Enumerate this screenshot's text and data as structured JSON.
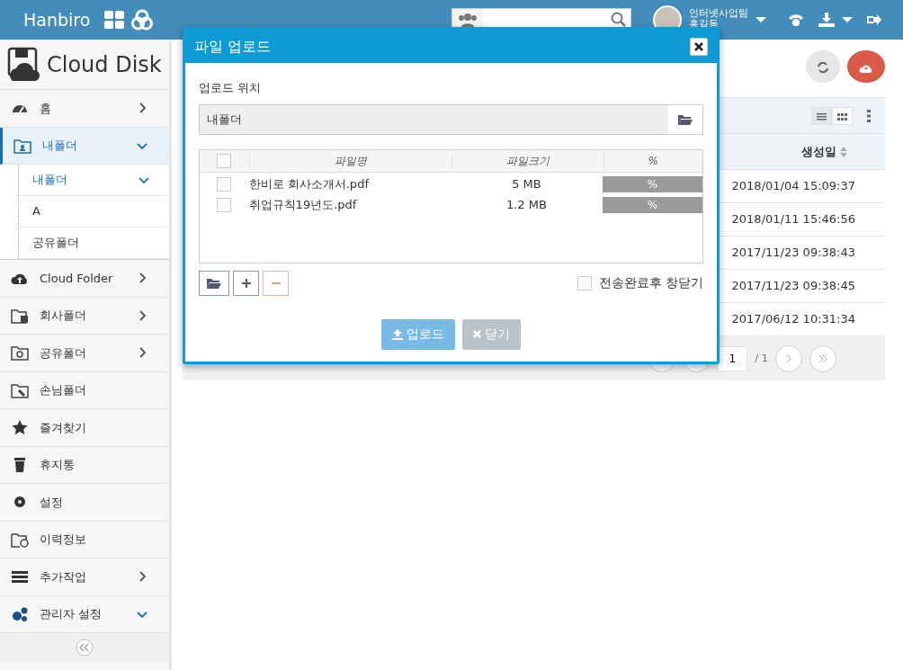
{
  "header": {
    "brand": "Hanbiro",
    "user": {
      "team": "인터넷사업팀",
      "name": "홍길동"
    }
  },
  "sidebar": {
    "title": "Cloud Disk",
    "items": [
      {
        "kind": "branch",
        "label": "홈",
        "selected": false,
        "expanded": false
      },
      {
        "kind": "branch",
        "label": "내폴더",
        "selected": true,
        "expanded": true,
        "children": [
          {
            "kind": "branch",
            "label": "내폴더",
            "selected": true,
            "expanded": true
          },
          {
            "kind": "leaf",
            "label": "A",
            "selected": false
          },
          {
            "kind": "leaf",
            "label": "공유폴더",
            "selected": false
          }
        ]
      },
      {
        "kind": "branch",
        "label": "Cloud Folder",
        "selected": false,
        "expanded": false
      },
      {
        "kind": "branch",
        "label": "회사폴더",
        "selected": false,
        "expanded": false
      },
      {
        "kind": "branch",
        "label": "공유폴더",
        "selected": false,
        "expanded": false
      },
      {
        "kind": "leaf",
        "label": "손님폴더",
        "selected": false
      },
      {
        "kind": "leaf",
        "label": "즐겨찾기",
        "selected": false
      },
      {
        "kind": "leaf",
        "label": "휴지통",
        "selected": false
      },
      {
        "kind": "leaf",
        "label": "설정",
        "selected": false
      },
      {
        "kind": "leaf",
        "label": "이력정보",
        "selected": false
      },
      {
        "kind": "branch",
        "label": "추가작업",
        "selected": false,
        "expanded": false
      },
      {
        "kind": "branch",
        "label": "관리자 설정",
        "selected": false,
        "expanded": true
      }
    ]
  },
  "main": {
    "views": [
      {
        "kind": "list",
        "selected": true
      },
      {
        "kind": "grid",
        "selected": false
      }
    ],
    "table": {
      "columns": [
        "생성일"
      ],
      "rows": [
        "2018/01/04 15:09:37",
        "2018/01/11 15:46:56",
        "2017/11/23 09:38:43",
        "2017/11/23 09:38:45",
        "2017/06/12 10:31:34"
      ]
    },
    "pagination": {
      "page": "1",
      "total": "/ 1"
    }
  },
  "dialog": {
    "title": "파일 업로드",
    "location_label": "업로드 위치",
    "location_value": "내폴더",
    "columns": [
      "파일명",
      "파일크기",
      "%"
    ],
    "select_all_checked": false,
    "files": [
      {
        "name": "한비로 회사소개서.pdf",
        "size": "5 MB",
        "progress": "%",
        "level": 0,
        "checked": false
      },
      {
        "name": "취업규칙19년도.pdf",
        "size": "1.2 MB",
        "progress": "%",
        "level": 0,
        "checked": false
      }
    ],
    "close_after": {
      "label": "전송완료후 창닫기",
      "checked": false
    },
    "buttons": [
      {
        "label": "업로드",
        "kind": "upload",
        "disabled": true
      },
      {
        "label": "닫기",
        "kind": "close",
        "disabled": true
      }
    ]
  }
}
